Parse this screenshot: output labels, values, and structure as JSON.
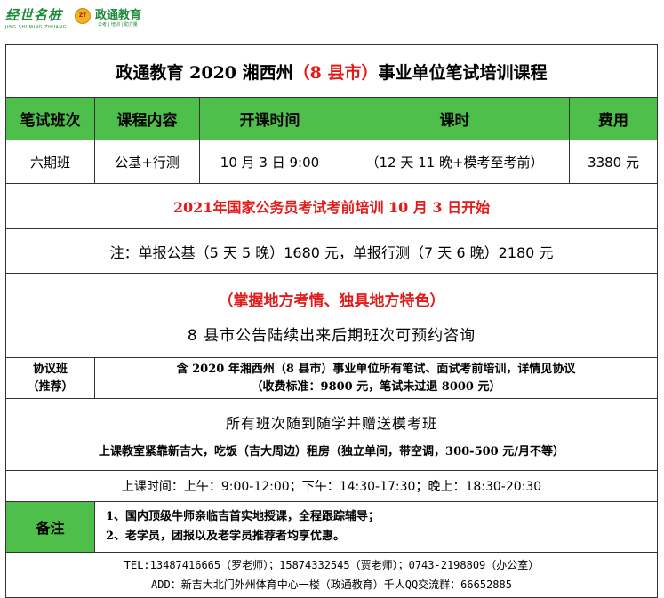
{
  "logos": {
    "left_name": "经世名桩",
    "left_sub": "JING SHI MING ZHUANG",
    "seal_text": "ZT",
    "right_name": "政通教育",
    "right_slogan": "公考 | 培训 | 助力量"
  },
  "title": {
    "part1": "政通教育 2020 湘西州",
    "part2": "（8 县市）",
    "part3": "事业单位笔试培训课程"
  },
  "header": [
    "笔试班次",
    "课程内容",
    "开课时间",
    "课时",
    "费用"
  ],
  "row": [
    "六期班",
    "公基+行测",
    "10 月 3 日 9:00",
    "（12 天 11 晚+模考至考前）",
    "3380 元"
  ],
  "national_exam": "2021年国家公务员考试考前培训 10 月 3 日开始",
  "single_note": "注：单报公基（5 天 5 晚）1680 元，单报行测（7 天 6 晚）2180 元",
  "grasp": {
    "line1": "（掌握地方考情、独具地方特色）",
    "line2": "8 县市公告陆续出来后期班次可预约咨询"
  },
  "agreement": {
    "label_line1": "协议班",
    "label_line2": "（推荐）",
    "text_line1": "含 2020 年湘西州（8 县市）事业单位所有笔试、面试考前培训，详情见协议",
    "text_line2": "（收费标准：9800 元，笔试未过退 8000 元）"
  },
  "follow": {
    "line1": "所有班次随到随学并赠送模考班",
    "line2": "上课教室紧靠新吉大，吃饭（吉大周边）租房（独立单间，带空调，300-500 元/月不等）"
  },
  "class_time": "上课时间：上午：9:00-12:00；下午：14:30-17:30；晚上：18:30-20:30",
  "remarks": {
    "label": "备注",
    "line1": "1、国内顶级牛师亲临吉首实地授课，全程跟踪辅导；",
    "line2": "2、老学员，团报以及老学员推荐者均享优惠。"
  },
  "contact": {
    "tel": "TEL:13487416665（罗老师）；15874332545（贾老师）；0743-2198809（办公室）",
    "address": "ADD：新吉大北门外州体育中心一楼（政通教育）千人QQ交流群：66652885"
  },
  "colors": {
    "header_green": "#4fbf4b",
    "accent_red": "#e31b1b",
    "logo_green": "#1f8a3a",
    "seal_gold": "#f2b516"
  }
}
